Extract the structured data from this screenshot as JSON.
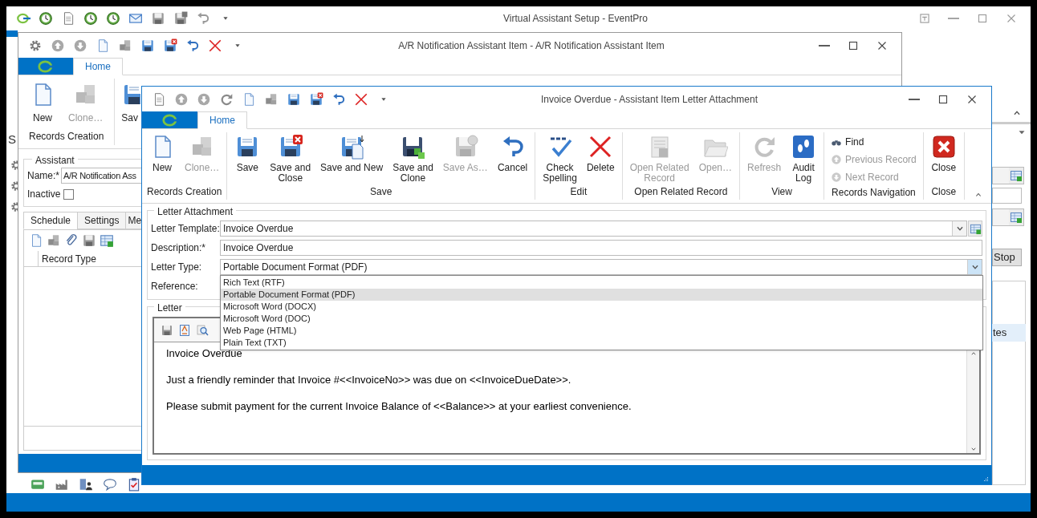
{
  "main_window": {
    "title": "Virtual Assistant Setup - EventPro",
    "sidebar_heading": "S",
    "stop_button": "Stop",
    "list_cell": "tes"
  },
  "assistant_window": {
    "title": "A/R Notification Assistant Item - A/R Notification Assistant Item",
    "ribbon_tabs": [
      {
        "label": "Home",
        "selected": true
      }
    ],
    "ribbon_buttons": [
      {
        "label": "New",
        "disabled": false
      },
      {
        "label": "Clone…",
        "disabled": true
      },
      {
        "label": "Sav",
        "disabled": false
      }
    ],
    "ribbon_group": "Records Creation",
    "assistant": {
      "title": "Assistant",
      "name_label": "Name:*",
      "name_value": "A/R Notification Ass",
      "inactive_label": "Inactive",
      "inactive_checked": false
    },
    "tabs": [
      {
        "label": "Schedule",
        "selected": true
      },
      {
        "label": "Settings",
        "selected": false
      },
      {
        "label": "Me",
        "selected": false
      }
    ],
    "columns": [
      "Record Type"
    ]
  },
  "letter_window": {
    "title": "Invoice Overdue - Assistant Item Letter Attachment",
    "ribbon_tabs": [
      {
        "label": "Home",
        "selected": true
      }
    ],
    "ribbon_groups": [
      {
        "label": "Records Creation",
        "kind": "large",
        "buttons": [
          {
            "lines": [
              "New"
            ],
            "disabled": false
          },
          {
            "lines": [
              "Clone…"
            ],
            "disabled": true
          }
        ]
      },
      {
        "label": "Save",
        "kind": "large",
        "buttons": [
          {
            "lines": [
              "Save"
            ],
            "disabled": false
          },
          {
            "lines": [
              "Save and",
              "Close"
            ],
            "disabled": false
          },
          {
            "lines": [
              "Save and New"
            ],
            "disabled": false
          },
          {
            "lines": [
              "Save and",
              "Clone"
            ],
            "disabled": false
          },
          {
            "lines": [
              "Save As…"
            ],
            "disabled": true
          },
          {
            "lines": [
              "Cancel"
            ],
            "disabled": false
          }
        ]
      },
      {
        "label": "Edit",
        "kind": "large",
        "buttons": [
          {
            "lines": [
              "Check",
              "Spelling"
            ],
            "disabled": false
          },
          {
            "lines": [
              "Delete"
            ],
            "disabled": false
          }
        ]
      },
      {
        "label": "Open Related Record",
        "kind": "large",
        "buttons": [
          {
            "lines": [
              "Open Related",
              "Record"
            ],
            "disabled": true
          },
          {
            "lines": [
              "Open…"
            ],
            "disabled": true
          }
        ]
      },
      {
        "label": "View",
        "kind": "large",
        "buttons": [
          {
            "lines": [
              "Refresh"
            ],
            "disabled": true
          },
          {
            "lines": [
              "Audit",
              "Log"
            ],
            "disabled": false
          }
        ]
      },
      {
        "label": "Records Navigation",
        "kind": "list",
        "buttons": [
          {
            "lines": [
              "Find"
            ],
            "disabled": false
          },
          {
            "lines": [
              "Previous Record"
            ],
            "disabled": true
          },
          {
            "lines": [
              "Next Record"
            ],
            "disabled": true
          }
        ]
      },
      {
        "label": "Close",
        "kind": "large",
        "buttons": [
          {
            "lines": [
              "Close"
            ],
            "disabled": false
          }
        ]
      }
    ],
    "letter_attachment": {
      "title": "Letter Attachment",
      "fields": [
        {
          "label": "Letter Template:",
          "value": "Invoice Overdue",
          "kind": "combo"
        },
        {
          "label": "Description:*",
          "value": "Invoice Overdue",
          "kind": "text"
        },
        {
          "label": "Letter Type:",
          "value": "Portable Document Format (PDF)",
          "kind": "dropdown",
          "expanded": true
        },
        {
          "label": "Reference:",
          "kind": "label"
        }
      ]
    },
    "letter_type_options": [
      {
        "label": "Rich Text (RTF)",
        "selected": false
      },
      {
        "label": "Portable Document Format (PDF)",
        "selected": true
      },
      {
        "label": "Microsoft Word (DOCX)",
        "selected": false
      },
      {
        "label": "Microsoft Word (DOC)",
        "selected": false
      },
      {
        "label": "Web Page (HTML)",
        "selected": false
      },
      {
        "label": "Plain Text (TXT)",
        "selected": false
      }
    ],
    "letter": {
      "title": "Letter",
      "paragraphs": [
        "Invoice Overdue",
        "Just a friendly reminder that Invoice #<<InvoiceNo>> was due on <<InvoiceDueDate>>.",
        "Please submit payment for the current Invoice Balance of <<Balance>> at your earliest convenience."
      ]
    }
  }
}
